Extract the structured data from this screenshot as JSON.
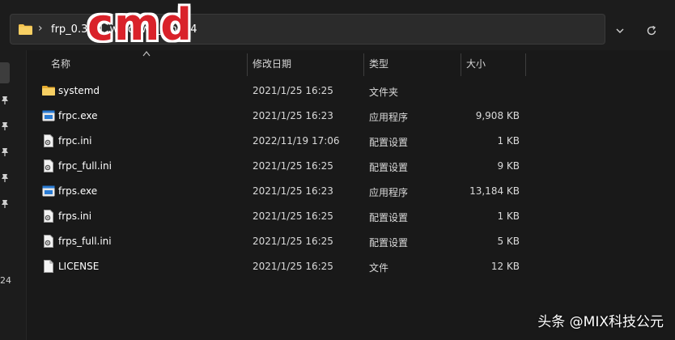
{
  "address_bar": {
    "path_text": "frp_0.35.1_windows_amd64",
    "overlay_label": "cmd"
  },
  "columns": {
    "name": "名称",
    "date": "修改日期",
    "type": "类型",
    "size": "大小"
  },
  "files": [
    {
      "name": "systemd",
      "date": "2021/1/25 16:25",
      "type": "文件夹",
      "size": "",
      "icon": "folder-icon"
    },
    {
      "name": "frpc.exe",
      "date": "2021/1/25 16:23",
      "type": "应用程序",
      "size": "9,908 KB",
      "icon": "exe-icon"
    },
    {
      "name": "frpc.ini",
      "date": "2022/11/19 17:06",
      "type": "配置设置",
      "size": "1 KB",
      "icon": "ini-file-icon"
    },
    {
      "name": "frpc_full.ini",
      "date": "2021/1/25 16:25",
      "type": "配置设置",
      "size": "9 KB",
      "icon": "ini-file-icon"
    },
    {
      "name": "frps.exe",
      "date": "2021/1/25 16:23",
      "type": "应用程序",
      "size": "13,184 KB",
      "icon": "exe-icon"
    },
    {
      "name": "frps.ini",
      "date": "2021/1/25 16:25",
      "type": "配置设置",
      "size": "1 KB",
      "icon": "ini-file-icon"
    },
    {
      "name": "frps_full.ini",
      "date": "2021/1/25 16:25",
      "type": "配置设置",
      "size": "5 KB",
      "icon": "ini-file-icon"
    },
    {
      "name": "LICENSE",
      "date": "2021/1/25 16:25",
      "type": "文件",
      "size": "12 KB",
      "icon": "file-icon"
    }
  ],
  "nav": {
    "partial_label": "24"
  },
  "watermark": "头条 @MIX科技公元",
  "colors": {
    "background": "#191919",
    "folder": "#f2c14e",
    "exe_blue": "#2a7bd3",
    "overlay_red": "#d9222a"
  }
}
